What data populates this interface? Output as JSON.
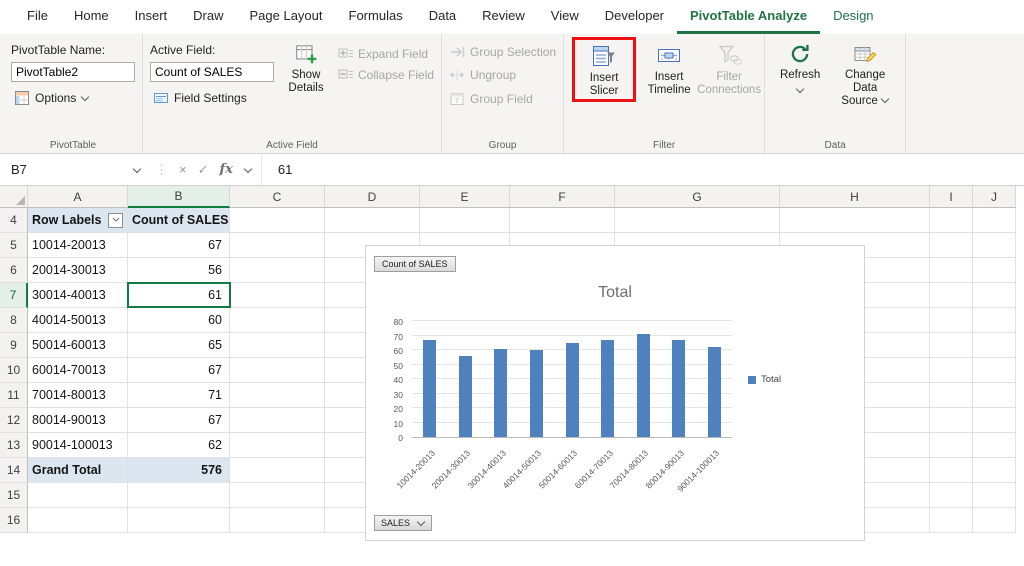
{
  "colors": {
    "excel_green": "#217346",
    "selection_green": "#107C41",
    "bar_blue": "#4E81BD",
    "pivot_header_bg": "#DCE6F1",
    "highlight_red": "#EE1111",
    "disabled_text": "#A6A6A6"
  },
  "tabs": [
    {
      "label": "File"
    },
    {
      "label": "Home"
    },
    {
      "label": "Insert"
    },
    {
      "label": "Draw"
    },
    {
      "label": "Page Layout"
    },
    {
      "label": "Formulas"
    },
    {
      "label": "Data"
    },
    {
      "label": "Review"
    },
    {
      "label": "View"
    },
    {
      "label": "Developer"
    },
    {
      "label": "PivotTable Analyze",
      "active": true,
      "contextual": true
    },
    {
      "label": "Design",
      "contextual": true
    }
  ],
  "ribbon": {
    "pivottable_group": {
      "label": "PivotTable",
      "name_label": "PivotTable Name:",
      "name_value": "PivotTable2",
      "options_label": "Options"
    },
    "active_field_group": {
      "label": "Active Field",
      "field_label": "Active Field:",
      "field_value": "Count of SALES",
      "field_settings_label": "Field Settings",
      "show_details_label": "Show Details",
      "expand_field_label": "Expand Field",
      "collapse_field_label": "Collapse Field"
    },
    "group_group": {
      "label": "Group",
      "items": [
        {
          "label": "Group Selection"
        },
        {
          "label": "Ungroup"
        },
        {
          "label": "Group Field"
        }
      ]
    },
    "filter_group": {
      "label": "Filter",
      "insert_slicer_label": "Insert Slicer",
      "insert_timeline_label": "Insert Timeline",
      "filter_connections_label": "Filter Connections"
    },
    "data_group": {
      "label": "Data",
      "refresh_label": "Refresh",
      "change_data_source_label": "Change Data Source"
    }
  },
  "formula_bar": {
    "name_box": "B7",
    "fx_label": "fx",
    "value": "61"
  },
  "grid": {
    "column_headers": [
      "A",
      "B",
      "C",
      "D",
      "E",
      "F",
      "G",
      "H",
      "I",
      "J"
    ],
    "row_start": 4,
    "row_end": 16,
    "selected_cell": "B7",
    "pivot": {
      "headers": [
        "Row Labels",
        "Count of SALES"
      ],
      "rows": [
        [
          "10014-20013",
          "67"
        ],
        [
          "20014-30013",
          "56"
        ],
        [
          "30014-40013",
          "61"
        ],
        [
          "40014-50013",
          "60"
        ],
        [
          "50014-60013",
          "65"
        ],
        [
          "60014-70013",
          "67"
        ],
        [
          "70014-80013",
          "71"
        ],
        [
          "80014-90013",
          "67"
        ],
        [
          "90014-100013",
          "62"
        ]
      ],
      "grand_total": [
        "Grand Total",
        "576"
      ]
    }
  },
  "chart": {
    "field_button_label": "Count of SALES",
    "axis_button_label": "SALES",
    "legend_label": "Total"
  },
  "chart_data": {
    "type": "bar",
    "title": "Total",
    "categories": [
      "10014-20013",
      "20014-30013",
      "30014-40013",
      "40014-50013",
      "50014-60013",
      "60014-70013",
      "70014-80013",
      "80014-90013",
      "90014-100013"
    ],
    "series": [
      {
        "name": "Total",
        "values": [
          67,
          56,
          61,
          60,
          65,
          67,
          71,
          67,
          62
        ]
      }
    ],
    "xlabel": "",
    "ylabel": "",
    "ylim": [
      0,
      80
    ],
    "yticks": [
      0,
      10,
      20,
      30,
      40,
      50,
      60,
      70,
      80
    ],
    "grid": true,
    "legend_position": "right",
    "bar_color": "#4E81BD"
  }
}
